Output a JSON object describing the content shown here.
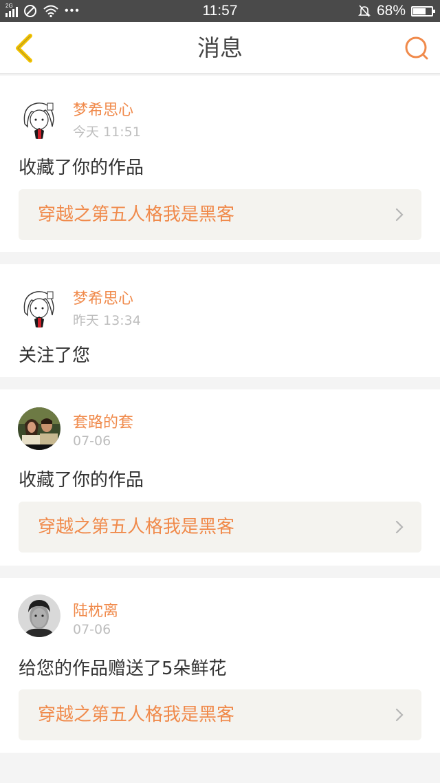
{
  "status_bar": {
    "network": "2G",
    "time": "11:57",
    "battery": "68%",
    "battery_level": 0.68
  },
  "header": {
    "title": "消息"
  },
  "messages": [
    {
      "user": "梦希思心",
      "time": "今天 11:51",
      "action": "收藏了你的作品",
      "work": "穿越之第五人格我是黑客",
      "avatar": "anime-girl-avatar"
    },
    {
      "user": "梦希思心",
      "time": "昨天 13:34",
      "action": "关注了您",
      "avatar": "anime-girl-avatar"
    },
    {
      "user": "套路的套",
      "time": "07-06",
      "action": "收藏了你的作品",
      "work": "穿越之第五人格我是黑客",
      "avatar": "couple-photo-avatar"
    },
    {
      "user": "陆枕离",
      "time": "07-06",
      "action": "给您的作品赠送了5朵鲜花",
      "work": "穿越之第五人格我是黑客",
      "avatar": "man-portrait-avatar"
    }
  ],
  "colors": {
    "accent": "#f08a4b",
    "back_arrow": "#f2c200",
    "muted": "#bdbdbd",
    "card_link_bg": "#f4f3ef"
  }
}
